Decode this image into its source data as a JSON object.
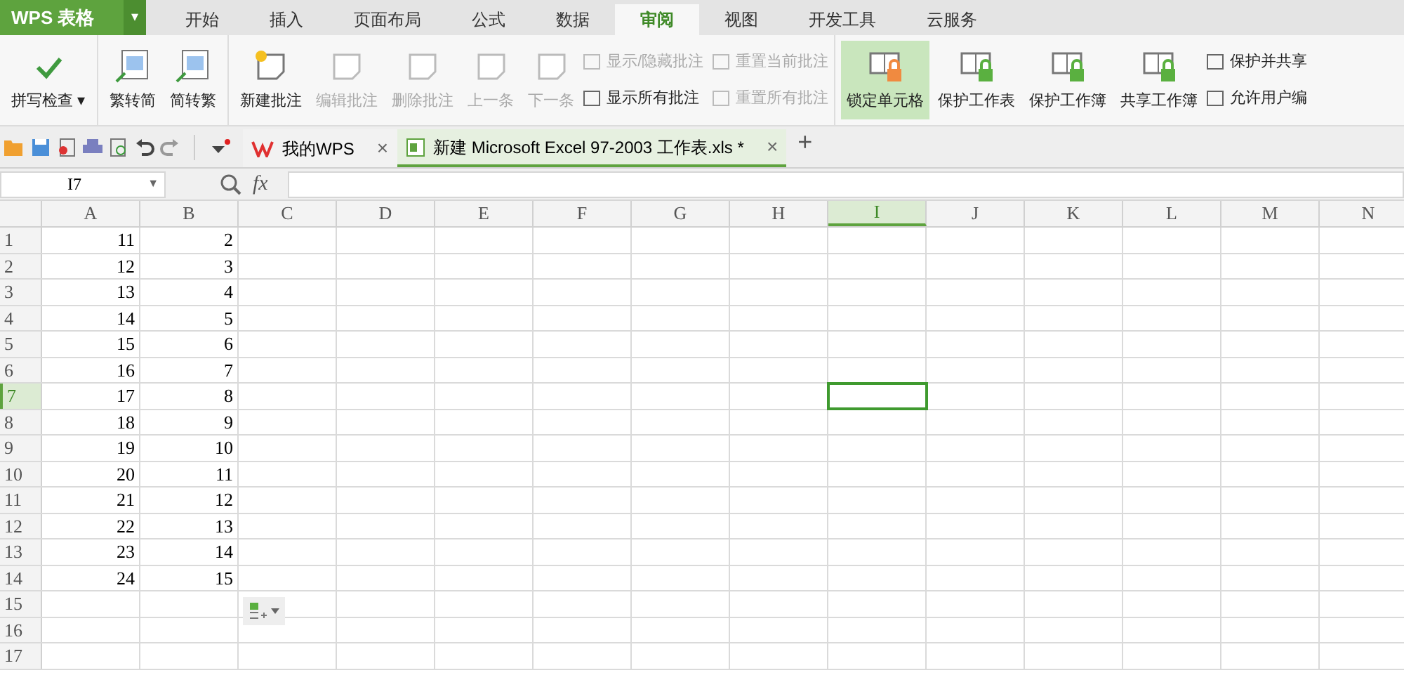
{
  "app_button": {
    "label": "WPS 表格",
    "caret": "▾"
  },
  "menu_tabs": [
    {
      "label": "开始",
      "selected": false
    },
    {
      "label": "插入",
      "selected": false
    },
    {
      "label": "页面布局",
      "selected": false
    },
    {
      "label": "公式",
      "selected": false
    },
    {
      "label": "数据",
      "selected": false
    },
    {
      "label": "审阅",
      "selected": true
    },
    {
      "label": "视图",
      "selected": false
    },
    {
      "label": "开发工具",
      "selected": false
    },
    {
      "label": "云服务",
      "selected": false
    }
  ],
  "ribbon_groups": [
    {
      "large": [
        {
          "label": "拼写检查",
          "caret": "▾",
          "disabled": false,
          "selected": false
        }
      ]
    },
    {
      "large": [
        {
          "label": "繁转简",
          "disabled": false,
          "selected": false
        },
        {
          "label": "简转繁",
          "disabled": false,
          "selected": false
        }
      ]
    },
    {
      "large": [
        {
          "label": "新建批注",
          "disabled": false,
          "selected": false
        },
        {
          "label": "编辑批注",
          "disabled": true,
          "selected": false
        },
        {
          "label": "删除批注",
          "disabled": true,
          "selected": false
        },
        {
          "label": "上一条",
          "disabled": true,
          "selected": false
        },
        {
          "label": "下一条",
          "disabled": true,
          "selected": false
        }
      ],
      "small": [
        {
          "label": "显示/隐藏批注",
          "disabled": true
        },
        {
          "label": "显示所有批注",
          "disabled": false
        },
        {
          "label": "重置当前批注",
          "disabled": true
        },
        {
          "label": "重置所有批注",
          "disabled": true
        }
      ]
    },
    {
      "large": [
        {
          "label": "锁定单元格",
          "disabled": false,
          "selected": true
        },
        {
          "label": "保护工作表",
          "disabled": false,
          "selected": false
        },
        {
          "label": "保护工作簿",
          "disabled": false,
          "selected": false
        },
        {
          "label": "共享工作簿",
          "disabled": false,
          "selected": false
        }
      ],
      "small": [
        {
          "label": "保护并共享",
          "disabled": false
        },
        {
          "label": "允许用户编",
          "disabled": false
        }
      ]
    }
  ],
  "doc_tabs": [
    {
      "label": "我的WPS",
      "close": "×",
      "selected": false
    },
    {
      "label": "新建 Microsoft Excel 97-2003 工作表.xls *",
      "close": "×",
      "selected": true
    }
  ],
  "new_tab": "+",
  "name_box": "I7",
  "name_box_caret": "▼",
  "fx": "fx",
  "sheet": {
    "columns": [
      {
        "label": "A",
        "selected": false
      },
      {
        "label": "B",
        "selected": false
      },
      {
        "label": "C",
        "selected": false
      },
      {
        "label": "D",
        "selected": false
      },
      {
        "label": "E",
        "selected": false
      },
      {
        "label": "F",
        "selected": false
      },
      {
        "label": "G",
        "selected": false
      },
      {
        "label": "H",
        "selected": false
      },
      {
        "label": "I",
        "selected": true
      },
      {
        "label": "J",
        "selected": false
      },
      {
        "label": "K",
        "selected": false
      },
      {
        "label": "L",
        "selected": false
      },
      {
        "label": "M",
        "selected": false
      },
      {
        "label": "N",
        "selected": false
      }
    ],
    "rows": [
      {
        "header": "1",
        "selected": false,
        "cells": [
          "11",
          "2"
        ]
      },
      {
        "header": "2",
        "selected": false,
        "cells": [
          "12",
          "3"
        ]
      },
      {
        "header": "3",
        "selected": false,
        "cells": [
          "13",
          "4"
        ]
      },
      {
        "header": "4",
        "selected": false,
        "cells": [
          "14",
          "5"
        ]
      },
      {
        "header": "5",
        "selected": false,
        "cells": [
          "15",
          "6"
        ]
      },
      {
        "header": "6",
        "selected": false,
        "cells": [
          "16",
          "7"
        ]
      },
      {
        "header": "7",
        "selected": true,
        "cells": [
          "17",
          "8"
        ]
      },
      {
        "header": "8",
        "selected": false,
        "cells": [
          "18",
          "9"
        ]
      },
      {
        "header": "9",
        "selected": false,
        "cells": [
          "19",
          "10"
        ]
      },
      {
        "header": "10",
        "selected": false,
        "cells": [
          "20",
          "11"
        ]
      },
      {
        "header": "11",
        "selected": false,
        "cells": [
          "21",
          "12"
        ]
      },
      {
        "header": "12",
        "selected": false,
        "cells": [
          "22",
          "13"
        ]
      },
      {
        "header": "13",
        "selected": false,
        "cells": [
          "23",
          "14"
        ]
      },
      {
        "header": "14",
        "selected": false,
        "cells": [
          "24",
          "15"
        ]
      },
      {
        "header": "15",
        "selected": false,
        "cells": []
      },
      {
        "header": "16",
        "selected": false,
        "cells": []
      },
      {
        "header": "17",
        "selected": false,
        "cells": []
      }
    ]
  }
}
